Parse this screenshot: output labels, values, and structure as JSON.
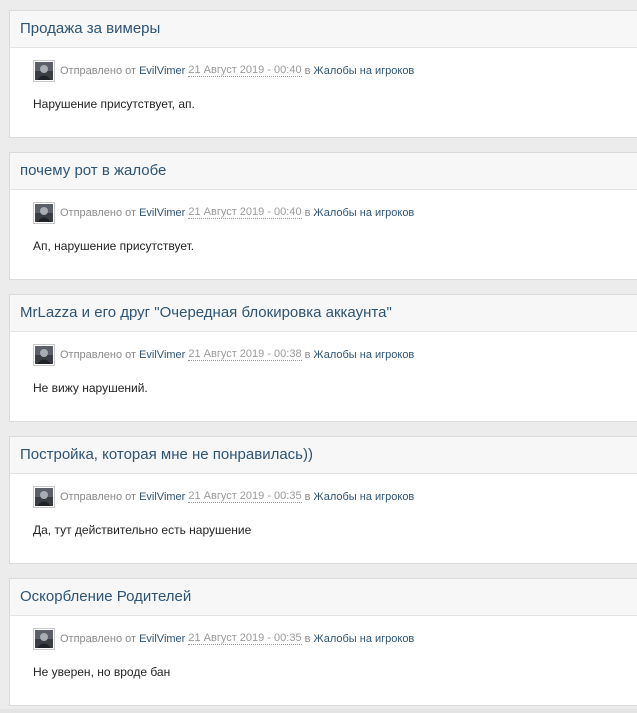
{
  "posts": [
    {
      "title": "Продажа за вимеры",
      "sent_label": "Отправлено от",
      "author": "EvilVimer",
      "date": "21 Август 2019 - 00:40",
      "in_label": "в",
      "forum": "Жалобы на игроков",
      "body": "Нарушение присутствует, ап."
    },
    {
      "title": "почему рот в жалобе",
      "sent_label": "Отправлено от",
      "author": "EvilVimer",
      "date": "21 Август 2019 - 00:40",
      "in_label": "в",
      "forum": "Жалобы на игроков",
      "body": "Ап, нарушение присутствует."
    },
    {
      "title": "MrLazza и его друг \"Очередная блокировка аккаунта\"",
      "sent_label": "Отправлено от",
      "author": "EvilVimer",
      "date": "21 Август 2019 - 00:38",
      "in_label": "в",
      "forum": "Жалобы на игроков",
      "body": "Не вижу нарушений."
    },
    {
      "title": "Постройка, которая мне не понравилась))",
      "sent_label": "Отправлено от",
      "author": "EvilVimer",
      "date": "21 Август 2019 - 00:35",
      "in_label": "в",
      "forum": "Жалобы на игроков",
      "body": "Да, тут действительно есть нарушение"
    },
    {
      "title": "Оскорбление Родителей",
      "sent_label": "Отправлено от",
      "author": "EvilVimer",
      "date": "21 Август 2019 - 00:35",
      "in_label": "в",
      "forum": "Жалобы на игроков",
      "body": "Не уверен, но вроде бан"
    }
  ],
  "avatar_icon": "user-avatar-icon",
  "colors": {
    "link": "#2d5473",
    "meta": "#8a8a8a",
    "body_text": "#222222",
    "header_bg": "#f7f7f7",
    "page_bg": "#ececec"
  }
}
